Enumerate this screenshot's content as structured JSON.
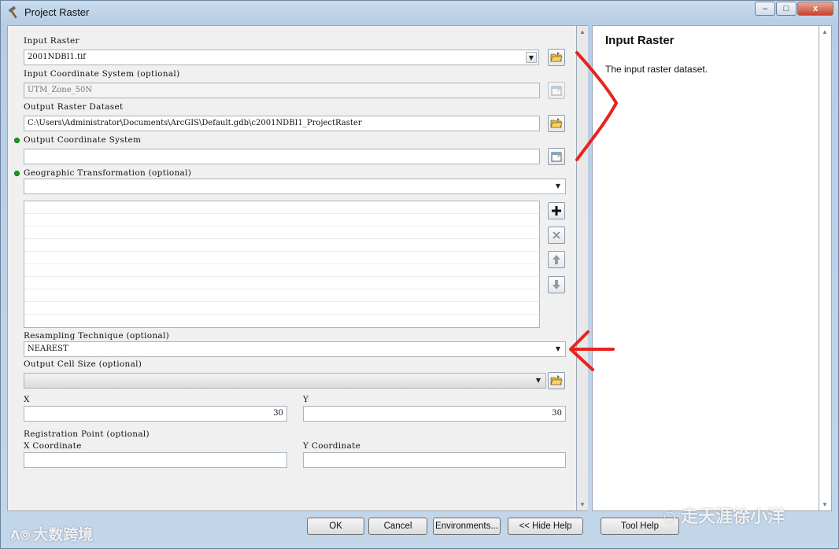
{
  "window": {
    "title": "Project Raster",
    "controls": {
      "minimize": "–",
      "maximize": "□",
      "close": "x"
    }
  },
  "form": {
    "input_raster": {
      "label": "Input Raster",
      "value": "2001NDBI1.tif"
    },
    "input_cs": {
      "label": "Input Coordinate System (optional)",
      "value": "UTM_Zone_50N"
    },
    "output_raster": {
      "label": "Output Raster Dataset",
      "value": "C:\\Users\\Administrator\\Documents\\ArcGIS\\Default.gdb\\c2001NDBI1_ProjectRaster"
    },
    "output_cs": {
      "label": "Output Coordinate System",
      "value": ""
    },
    "geo_transform": {
      "label": "Geographic Transformation (optional)",
      "value": ""
    },
    "resampling": {
      "label": "Resampling Technique (optional)",
      "value": "NEAREST"
    },
    "cell_size": {
      "label": "Output Cell Size (optional)",
      "value": "",
      "x_label": "X",
      "y_label": "Y",
      "x_value": "30",
      "y_value": "30"
    },
    "registration": {
      "label": "Registration Point (optional)",
      "x_label": "X Coordinate",
      "y_label": "Y Coordinate",
      "x_value": "",
      "y_value": ""
    }
  },
  "help": {
    "title": "Input Raster",
    "text": "The input raster dataset."
  },
  "buttons": {
    "ok": "OK",
    "cancel": "Cancel",
    "environments": "Environments...",
    "hide_help": "<< Hide Help",
    "tool_help": "Tool Help"
  },
  "watermarks": {
    "bottom_left": "大数跨境",
    "bottom_right": "走天涯徐小洋"
  },
  "colors": {
    "annotation": "#e8231f",
    "required_dot": "#19a019"
  }
}
